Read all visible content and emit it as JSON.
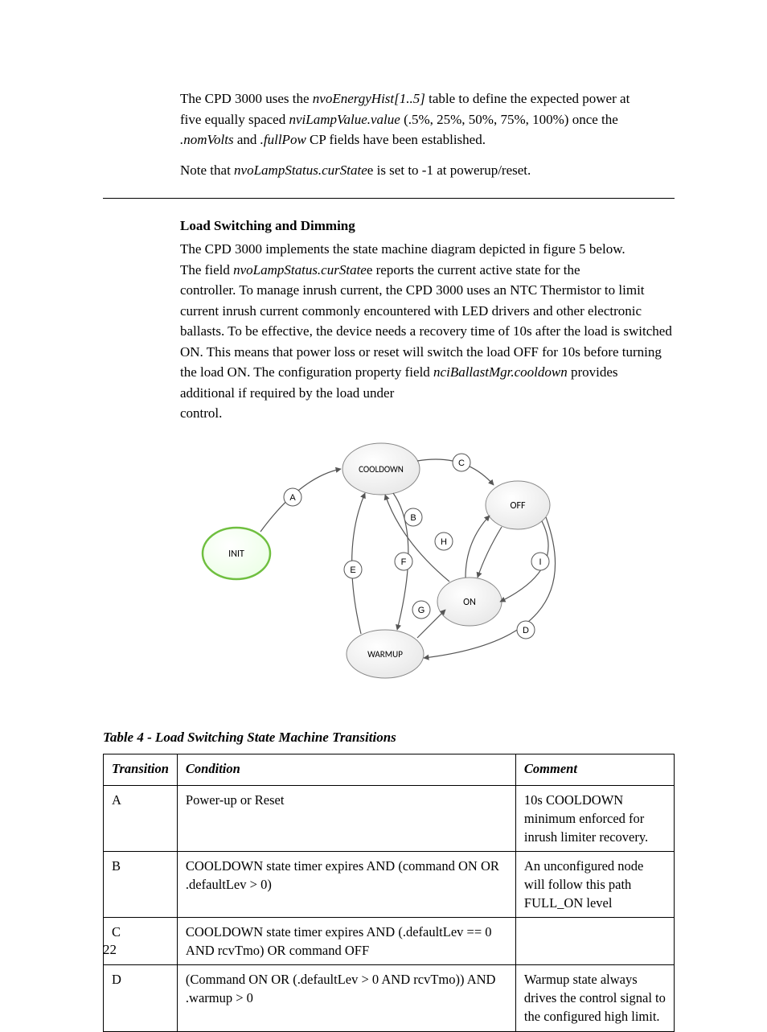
{
  "intro": {
    "l1a": "The CPD 3000 uses the ",
    "l1b_i": "nvoEnergyHist[1..5]",
    "l1c": " table to define the expected power at",
    "l2a": "five equally spaced ",
    "l2b_i": "nviLampValue.value",
    "l2c": " (.5%, 25%, 50%, 75%, 100%) once the",
    "l3a_i": ".nomVolts",
    "l3b": " and ",
    "l3c_i": ".fullPow",
    "l3d": " CP fields have been established.",
    "note_a": "Note that ",
    "note_b_i": "nvoLampStatus.curState",
    "note_c": "e is set to -1 at powerup/reset."
  },
  "section_heading": "Load Switching and Dimming",
  "body": {
    "p1": "The CPD 3000 implements the state machine diagram depicted in figure 5 below.",
    "p2a": "The field ",
    "p2b_i": "nvoLampStatus.curState",
    "p2c": "e reports the current active state for the",
    "p3": "controller.  To manage inrush current, the CPD 3000 uses an NTC Thermistor to limit current inrush current commonly encountered with LED drivers and other electronic ballasts.  To be effective, the device needs a recovery time of 10s after the load is switched ON.  This means that power loss or reset will switch the load OFF for 10s before turning the load ON.  The configuration property field ",
    "p4a_i": "nciBallastMgr.cooldown",
    "p4b": " provides additional if required by the load under",
    "p5": "control."
  },
  "diagram": {
    "states": {
      "init": "INIT",
      "cooldown": "COOLDOWN",
      "off": "OFF",
      "on": "ON",
      "warmup": "WARMUP"
    },
    "labels": [
      "A",
      "B",
      "C",
      "D",
      "E",
      "F",
      "G",
      "H",
      "I"
    ]
  },
  "table": {
    "caption": "Table 4 - Load Switching State Machine Transitions",
    "headers": [
      "Transition",
      "Condition",
      "Comment"
    ],
    "rows": [
      {
        "id": "A",
        "cond": "Power-up or Reset",
        "comment": "10s COOLDOWN minimum enforced for inrush limiter recovery."
      },
      {
        "id": "B",
        "cond": "COOLDOWN state timer expires AND (command ON OR .defaultLev > 0)",
        "comment": "An unconfigured node will follow this path FULL_ON level"
      },
      {
        "id": "C",
        "cond": "COOLDOWN state timer expires AND (.defaultLev == 0 AND rcvTmo) OR command OFF",
        "comment": ""
      },
      {
        "id": "D",
        "cond": "(Command ON OR (.defaultLev > 0 AND rcvTmo)) AND .warmup > 0",
        "comment": "Warmup state always drives the control signal to the configured high limit."
      }
    ]
  },
  "page_number": "22"
}
